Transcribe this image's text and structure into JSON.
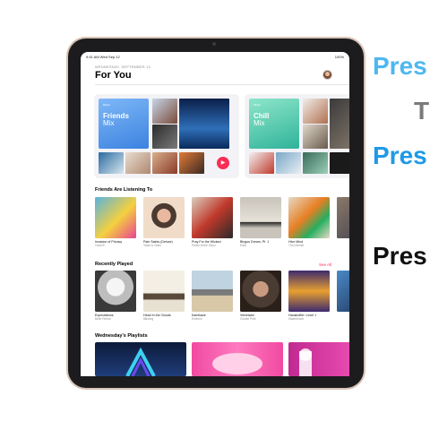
{
  "status_bar": {
    "time": "9:41 AM Wed Sep 12",
    "battery": "100%"
  },
  "header": {
    "date": "WEDNESDAY, SEPTEMBER 12",
    "title": "For You"
  },
  "mixes": [
    {
      "label": "Music",
      "title_1": "Friends",
      "title_2": "Mix"
    },
    {
      "label": "Music",
      "title_1": "Chill",
      "title_2": "Mix"
    }
  ],
  "sections": {
    "friends": "Friends Are Listening To",
    "recent": "Recently Played",
    "playlists": "Wednesday's Playlists",
    "see_all": "See All"
  },
  "friends_albums": [
    {
      "title": "Invasion of Privacy",
      "artist": "Cardi B",
      "color": "#5ab3e0"
    },
    {
      "title": "Pale Saints (Deluxe)",
      "artist": "Years & Years",
      "color": "#f0dcc8"
    },
    {
      "title": "Pray For the Wicked",
      "artist": "Panic! At the Disco",
      "color": "#d9cfc0"
    },
    {
      "title": "Bingos Dream, Pt. 1",
      "artist": "Eliza",
      "color": "#c8c3bb"
    },
    {
      "title": "Hive Mind",
      "artist": "The Internet",
      "color": "#e7d9c5"
    }
  ],
  "recent_albums": [
    {
      "title": "Expectations",
      "artist": "Bebe Rexha",
      "color": "#cfcfcf"
    },
    {
      "title": "Head In the Clouds",
      "artist": "88rising",
      "color": "#e8e1d2"
    },
    {
      "title": "Kamikaze",
      "artist": "Eminem",
      "color": "#bfd4e0"
    },
    {
      "title": "Velvetaire",
      "artist": "Charlie Puth",
      "color": "#4a3b33"
    },
    {
      "title": "Hausboffer: Level 1",
      "artist": "Waterbeach",
      "color": "#3d2a6e"
    }
  ],
  "promo_text": [
    "Pres",
    "T",
    "Pres",
    "Pres"
  ]
}
